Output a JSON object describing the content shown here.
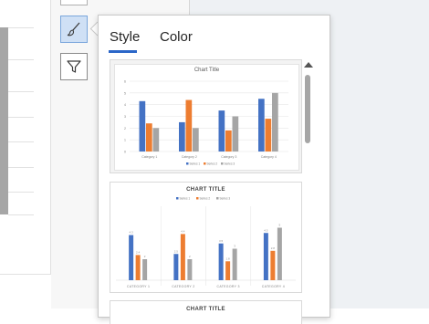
{
  "pane": {
    "tabs": [
      {
        "label": "Style",
        "active": true
      },
      {
        "label": "Color",
        "active": false
      }
    ]
  },
  "styles": [
    {
      "title": "Chart Title"
    },
    {
      "title": "CHART TITLE"
    },
    {
      "title": "CHART TITLE"
    }
  ],
  "colors": {
    "accent": "#2b66c8",
    "series1": "#4472c4",
    "series2": "#ed7d31",
    "series3": "#a5a5a5"
  },
  "icons": [
    "brush-icon",
    "filter-icon"
  ],
  "chart_data": [
    {
      "type": "bar",
      "title": "Chart Title",
      "categories": [
        "Category 1",
        "Category 2",
        "Category 3",
        "Category 4"
      ],
      "series": [
        {
          "name": "Series 1",
          "values": [
            4.3,
            2.5,
            3.5,
            4.5
          ]
        },
        {
          "name": "Series 2",
          "values": [
            2.4,
            4.4,
            1.8,
            2.8
          ]
        },
        {
          "name": "Series 3",
          "values": [
            2.0,
            2.0,
            3.0,
            5.0
          ]
        }
      ],
      "ylim": [
        0,
        6
      ],
      "yticks": [
        0,
        1,
        2,
        3,
        4,
        5,
        6
      ],
      "legend": "bottom",
      "grid": true
    },
    {
      "type": "bar",
      "title": "CHART TITLE",
      "categories": [
        "CATEGORY 1",
        "CATEGORY 2",
        "CATEGORY 3",
        "CATEGORY 4"
      ],
      "series": [
        {
          "name": "Series 1",
          "values": [
            4.3,
            2.5,
            3.5,
            4.5
          ]
        },
        {
          "name": "Series 2",
          "values": [
            2.4,
            4.4,
            1.8,
            2.8
          ]
        },
        {
          "name": "Series 3",
          "values": [
            2.0,
            2.0,
            3.0,
            5.0
          ]
        }
      ],
      "ylim": [
        0,
        6
      ],
      "legend": "top",
      "grid": false
    }
  ]
}
